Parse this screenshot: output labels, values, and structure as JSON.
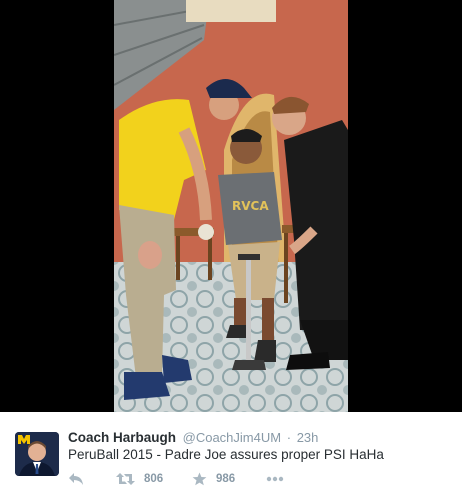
{
  "tweet": {
    "display_name": "Coach Harbaugh",
    "screen_name": "@CoachJim4UM",
    "separator": "·",
    "time": "23h",
    "text": "PeruBall 2015 - Padre Joe assures proper PSI HaHa"
  },
  "actions": {
    "reply_icon": "reply-icon",
    "retweet_icon": "retweet-icon",
    "retweet_count": "806",
    "favorite_icon": "star-icon",
    "favorite_count": "986",
    "more_icon": "more-dots-icon"
  },
  "colors": {
    "name": "#292f33",
    "meta": "#8899a6",
    "icon": "#aab8c2",
    "letterbox": "#000000"
  }
}
